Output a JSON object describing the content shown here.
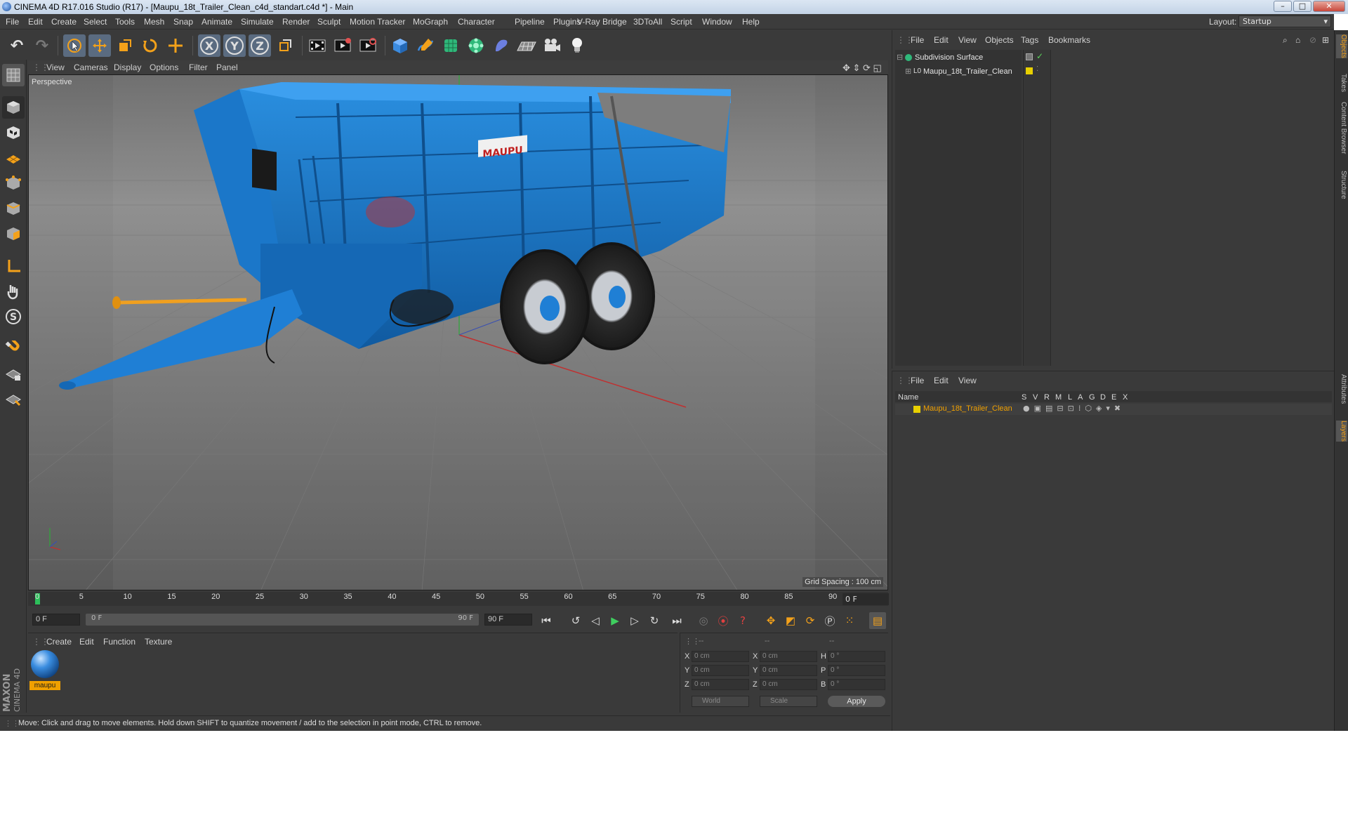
{
  "window": {
    "title": "CINEMA 4D R17.016 Studio (R17) - [Maupu_18t_Trailer_Clean_c4d_standart.c4d *] - Main",
    "controls": [
      "–",
      "□",
      "✕"
    ]
  },
  "menubar": {
    "items": [
      "File",
      "Edit",
      "Create",
      "Select",
      "Tools",
      "Mesh",
      "Snap",
      "Animate",
      "Simulate",
      "Render",
      "Sculpt",
      "Motion Tracker",
      "MoGraph",
      "Character",
      "Pipeline",
      "Plugins",
      "V-Ray Bridge",
      "3DToAll",
      "Script",
      "Window",
      "Help"
    ],
    "layout_label": "Layout:",
    "layout_value": "Startup"
  },
  "toolbar": {
    "axis_x": "X",
    "axis_y": "Y",
    "axis_z": "Z"
  },
  "viewport": {
    "menu": [
      "View",
      "Cameras",
      "Display",
      "Options",
      "Filter",
      "Panel"
    ],
    "label": "Perspective",
    "grid_spacing": "Grid Spacing : 100 cm",
    "decal_text": "MAUPU"
  },
  "timeline": {
    "ticks": [
      "0",
      "5",
      "10",
      "15",
      "20",
      "25",
      "30",
      "35",
      "40",
      "45",
      "50",
      "55",
      "60",
      "65",
      "70",
      "75",
      "80",
      "85",
      "90"
    ],
    "current_frame": "0 F",
    "start_field": "0 F",
    "range_start": "0 F",
    "range_end": "90 F",
    "end_field": "90 F"
  },
  "material_manager": {
    "menu": [
      "Create",
      "Edit",
      "Function",
      "Texture"
    ],
    "material_name": "maupu"
  },
  "coordinates": {
    "header": [
      "--",
      "--",
      "--"
    ],
    "rows": [
      {
        "l1": "X",
        "v1": "0 cm",
        "l2": "X",
        "v2": "0 cm",
        "l3": "H",
        "v3": "0 °"
      },
      {
        "l1": "Y",
        "v1": "0 cm",
        "l2": "Y",
        "v2": "0 cm",
        "l3": "P",
        "v3": "0 °"
      },
      {
        "l1": "Z",
        "v1": "0 cm",
        "l2": "Z",
        "v2": "0 cm",
        "l3": "B",
        "v3": "0 °"
      }
    ],
    "mode_world": "World",
    "mode_scale": "Scale",
    "apply": "Apply"
  },
  "status": {
    "text": "Move: Click and drag to move elements. Hold down SHIFT to quantize movement / add to the selection in point mode, CTRL to remove."
  },
  "object_manager": {
    "menu": [
      "File",
      "Edit",
      "View",
      "Objects",
      "Tags",
      "Bookmarks"
    ],
    "objects": [
      {
        "name": "Subdivision Surface"
      },
      {
        "name": "Maupu_18t_Trailer_Clean"
      }
    ]
  },
  "layer_manager": {
    "menu": [
      "File",
      "Edit",
      "View"
    ],
    "columns": [
      "Name",
      "S",
      "V",
      "R",
      "M",
      "L",
      "A",
      "G",
      "D",
      "E",
      "X"
    ],
    "layer_name": "Maupu_18t_Trailer_Clean"
  },
  "side_tabs": [
    "Objects",
    "Takes",
    "Content Browser",
    "Structure",
    "Attributes",
    "Layers"
  ],
  "branding": {
    "logo_text_1": "MAXON",
    "logo_text_2": "CINEMA 4D"
  },
  "colors": {
    "accent_orange": "#f0a000",
    "trailer_blue": "#1e7fd0",
    "layer_yellow": "#e8d000"
  }
}
